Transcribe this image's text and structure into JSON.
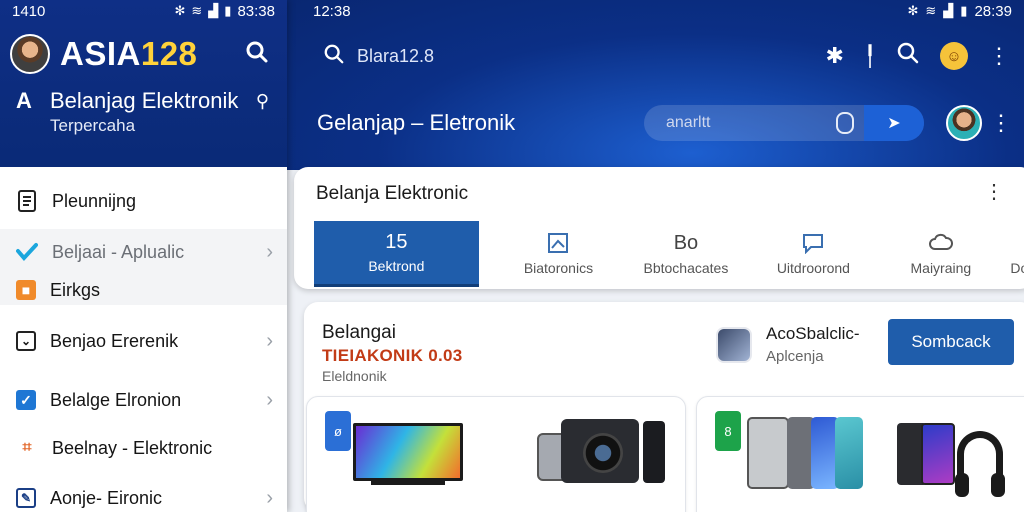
{
  "colors": {
    "header_blue": "#0b2f86",
    "accent_blue": "#1f5dab",
    "brand_yellow": "#ffd23a",
    "promo_red": "#c23b16"
  },
  "drawer": {
    "status": {
      "time": "1410",
      "clock": "83:38"
    },
    "brand_prefix": "ASIA",
    "brand_number": "128",
    "store_logo": "A",
    "store_title": "Belanjag Elektronik",
    "store_subtitle": "Terpercaha",
    "menu": [
      {
        "label": "Pleunnijng",
        "icon": "document-icon"
      },
      {
        "label": "Beljaai - Aplualic",
        "icon": "shield-check-icon",
        "chevron": true
      },
      {
        "label": "Eirkgs",
        "icon": "orange-tag-icon"
      },
      {
        "label": "Benjao Ererenik",
        "icon": "square-chevron-icon",
        "chevron": true
      },
      {
        "label": "Belalge Elronion",
        "icon": "checkbox-icon",
        "chevron": true
      },
      {
        "label": "Beelnay - Elektronic",
        "icon": "orange-x-icon"
      },
      {
        "label": "Aonje- Eironic",
        "icon": "edit-square-icon",
        "chevron": true
      }
    ]
  },
  "main": {
    "status": {
      "time": "12:38",
      "clock": "28:39"
    },
    "search_text": "Blara12.8",
    "title": "Gelanjap – Eletronik",
    "pill_text": "anarltt"
  },
  "categories": {
    "title": "Belanja Elektronic",
    "tabs": [
      {
        "count": "15",
        "label": "Bektrond",
        "active": true
      },
      {
        "label": "Biatoronics",
        "icon": "image-icon"
      },
      {
        "label": "Bbtochacates",
        "icon_text": "Bo"
      },
      {
        "label": "Uitdroorond",
        "icon": "chat-icon"
      },
      {
        "label": "Maiyraing",
        "icon": "cloud-icon"
      },
      {
        "label": "Do"
      }
    ]
  },
  "promo": {
    "line1": "Belangai",
    "line2": "TIEIAKONIK 0.03",
    "line3": "Eleldnonik",
    "app_name": "AcoSbalclic-",
    "app_sub": "Aplcenja",
    "button_label": "Sombcack",
    "products": [
      {
        "badge": "ø",
        "kind": "tv-camera"
      },
      {
        "badge": "8",
        "kind": "phones-headphones"
      }
    ]
  }
}
